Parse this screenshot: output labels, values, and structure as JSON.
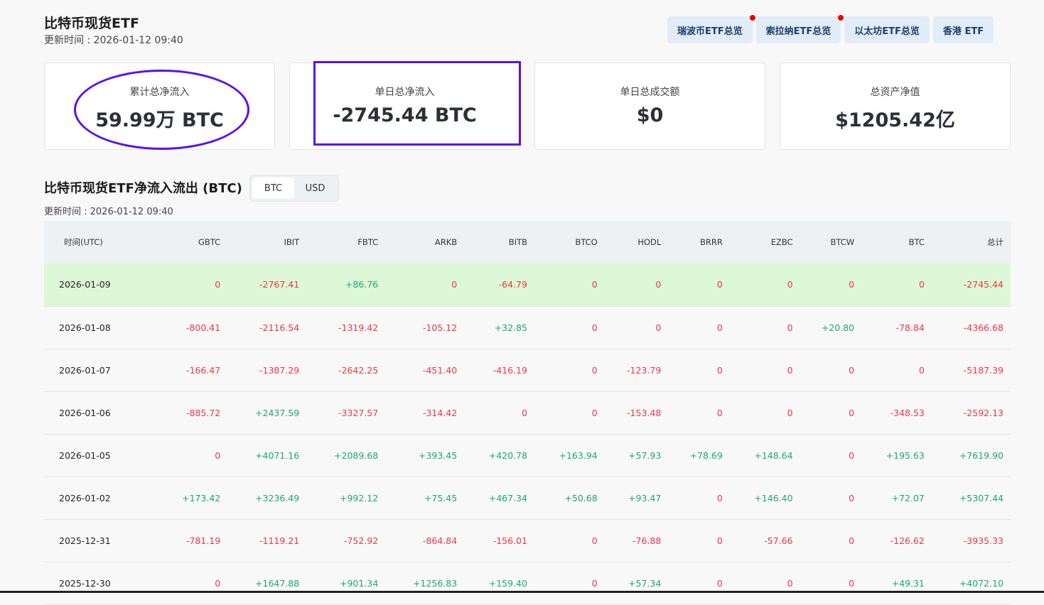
{
  "header": {
    "title": "比特币现货ETF",
    "updated": "更新时间 : 2026-01-12 09:40"
  },
  "nav": [
    {
      "label": "瑞波币ETF总览",
      "dot": true
    },
    {
      "label": "索拉纳ETF总览",
      "dot": true
    },
    {
      "label": "以太坊ETF总览",
      "dot": false
    },
    {
      "label": "香港 ETF",
      "dot": false
    }
  ],
  "cards": [
    {
      "label": "累计总净流入",
      "value": "59.99万 BTC"
    },
    {
      "label": "单日总净流入",
      "value": "-2745.44 BTC"
    },
    {
      "label": "单日总成交额",
      "value": "$0"
    },
    {
      "label": "总资产净值",
      "value": "$1205.42亿"
    }
  ],
  "section": {
    "title": "比特币现货ETF净流入流出 (BTC)",
    "updated": "更新时间 : 2026-01-12 09:40",
    "toggle": [
      "BTC",
      "USD"
    ],
    "active": "BTC"
  },
  "colors": {
    "negative": "#f0364a",
    "positive": "#1fa57a",
    "annotation": "#5b10f0"
  },
  "table": {
    "columns": [
      "时间(UTC)",
      "GBTC",
      "IBIT",
      "FBTC",
      "ARKB",
      "BITB",
      "BTCO",
      "HODL",
      "BRRR",
      "EZBC",
      "BTCW",
      "BTC",
      "总计"
    ],
    "rows": [
      [
        "2026-01-09",
        "0",
        "-2767.41",
        "+86.76",
        "0",
        "-64.79",
        "0",
        "0",
        "0",
        "0",
        "0",
        "0",
        "-2745.44"
      ],
      [
        "2026-01-08",
        "-800.41",
        "-2116.54",
        "-1319.42",
        "-105.12",
        "+32.85",
        "0",
        "0",
        "0",
        "0",
        "+20.80",
        "-78.84",
        "-4366.68"
      ],
      [
        "2026-01-07",
        "-166.47",
        "-1387.29",
        "-2642.25",
        "-451.40",
        "-416.19",
        "0",
        "-123.79",
        "0",
        "0",
        "0",
        "0",
        "-5187.39"
      ],
      [
        "2026-01-06",
        "-885.72",
        "+2437.59",
        "-3327.57",
        "-314.42",
        "0",
        "0",
        "-153.48",
        "0",
        "0",
        "0",
        "-348.53",
        "-2592.13"
      ],
      [
        "2026-01-05",
        "0",
        "+4071.16",
        "+2089.68",
        "+393.45",
        "+420.78",
        "+163.94",
        "+57.93",
        "+78.69",
        "+148.64",
        "0",
        "+195.63",
        "+7619.90"
      ],
      [
        "2026-01-02",
        "+173.42",
        "+3236.49",
        "+992.12",
        "+75.45",
        "+467.34",
        "+50.68",
        "+93.47",
        "0",
        "+146.40",
        "0",
        "+72.07",
        "+5307.44"
      ],
      [
        "2025-12-31",
        "-781.19",
        "-1119.21",
        "-752.92",
        "-864.84",
        "-156.01",
        "0",
        "-76.88",
        "0",
        "-57.66",
        "0",
        "-126.62",
        "-3935.33"
      ],
      [
        "2025-12-30",
        "0",
        "+1647.88",
        "+901.34",
        "+1256.83",
        "+159.40",
        "0",
        "+57.34",
        "0",
        "0",
        "0",
        "+49.31",
        "+4072.10"
      ]
    ]
  }
}
